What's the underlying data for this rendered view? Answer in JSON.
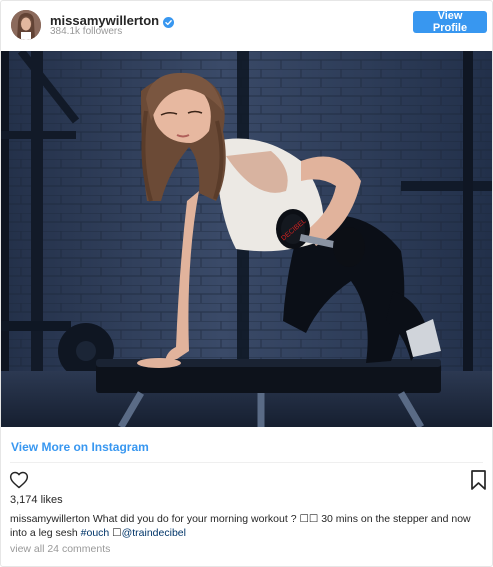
{
  "header": {
    "username": "missamywillerton",
    "followers": "384.1k followers",
    "view_profile_label": "View Profile"
  },
  "post": {
    "image_alt": "woman doing dumbbell row in gym",
    "dumbbell_text": "DECIBEL",
    "view_more_label": "View More on Instagram",
    "likes": "3,174 likes",
    "caption_username": "missamywillerton",
    "caption_text_1": " What did you do for your morning workout ? ☐☐ 30 mins on the stepper and now into a leg sesh ",
    "caption_hashtag": "#ouch",
    "caption_text_2": " ☐",
    "caption_mention": "@traindecibel",
    "comments_link": "view all 24 comments"
  },
  "colors": {
    "accent": "#3897f0",
    "link": "#003569",
    "muted": "#999999"
  },
  "icons": [
    "verified-badge-icon",
    "heart-icon",
    "bookmark-icon"
  ]
}
